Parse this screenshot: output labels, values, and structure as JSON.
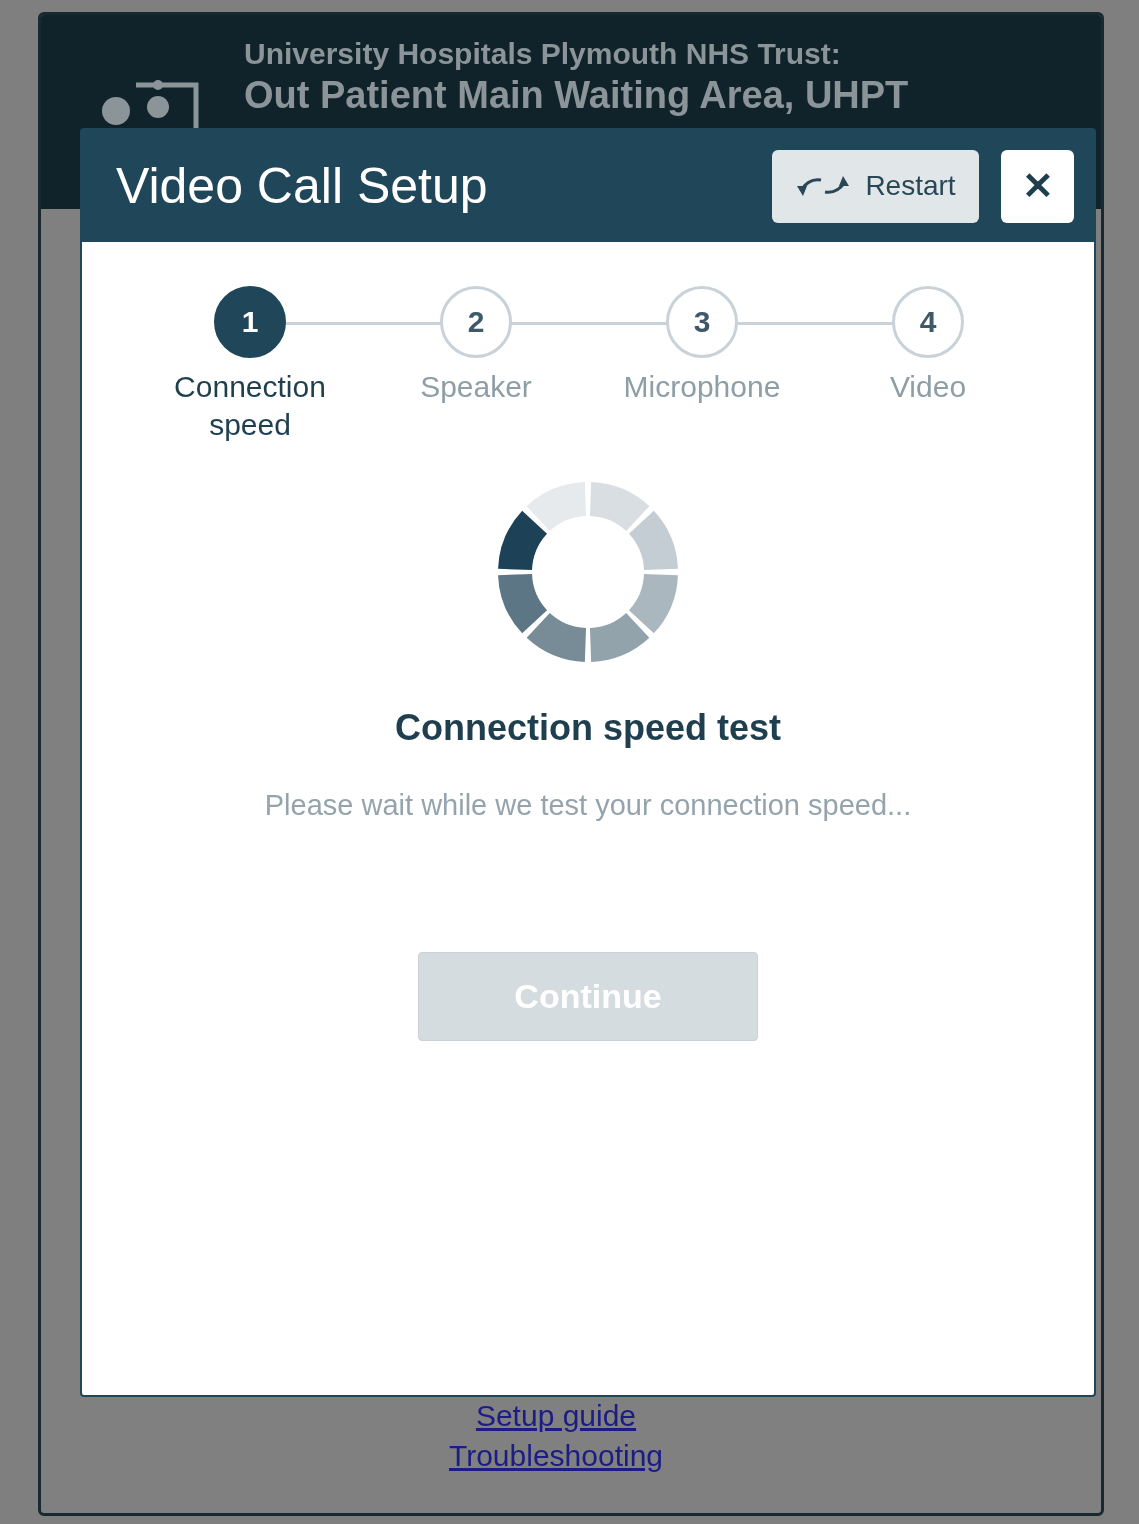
{
  "page": {
    "organisation": "University Hospitals Plymouth NHS Trust:",
    "waiting_area": "Out Patient Main Waiting Area, UHPT",
    "links": [
      "Setup guide",
      "Troubleshooting"
    ]
  },
  "dialog": {
    "title": "Video Call Setup",
    "restart_button": "Restart",
    "close_button": "✕",
    "steps": [
      {
        "number": "1",
        "label": "Connection speed",
        "selected": true
      },
      {
        "number": "2",
        "label": "Speaker",
        "selected": false
      },
      {
        "number": "3",
        "label": "Microphone",
        "selected": false
      },
      {
        "number": "4",
        "label": "Video",
        "selected": false
      }
    ],
    "heading": "Connection speed test",
    "message": "Please wait while we test your connection speed...",
    "continue_button": {
      "label": "Continue",
      "disabled": true
    }
  }
}
